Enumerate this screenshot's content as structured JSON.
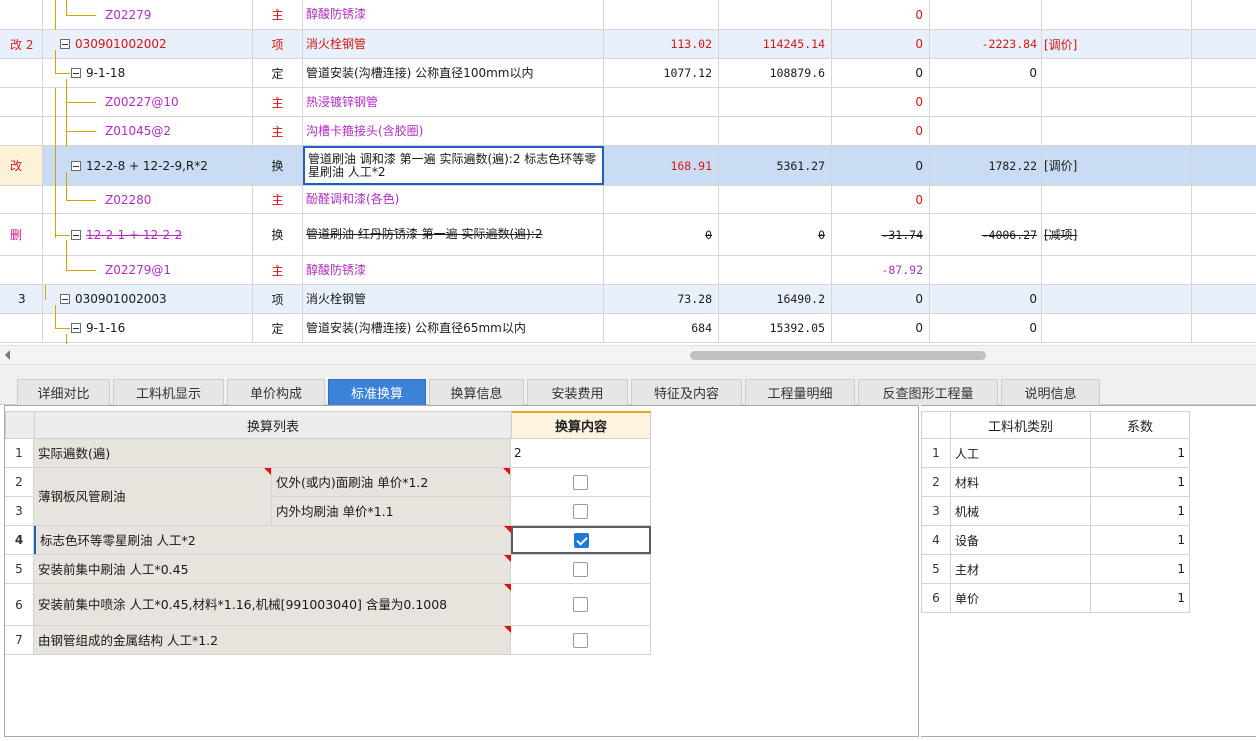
{
  "grid_rows": [
    {
      "mark": "",
      "code": "Z02279",
      "type": "主",
      "name": "醇酸防锈漆",
      "n1": "",
      "n2": "",
      "n3": "0",
      "n4": "",
      "note": ""
    },
    {
      "mark": "改 2",
      "code": "030901002002",
      "type": "项",
      "name": "消火栓钢管",
      "n1": "113.02",
      "n2": "114245.14",
      "n3": "0",
      "n4": "-2223.84",
      "note": "[调价]"
    },
    {
      "mark": "",
      "code": "9-1-18",
      "type": "定",
      "name": "管道安装(沟槽连接) 公称直径100mm以内",
      "n1": "1077.12",
      "n2": "108879.6",
      "n3": "0",
      "n4": "0",
      "note": ""
    },
    {
      "mark": "",
      "code": "Z00227@10",
      "type": "主",
      "name": "热浸镀锌钢管",
      "n1": "",
      "n2": "",
      "n3": "0",
      "n4": "",
      "note": ""
    },
    {
      "mark": "",
      "code": "Z01045@2",
      "type": "主",
      "name": "沟槽卡箍接头(含胶圈)",
      "n1": "",
      "n2": "",
      "n3": "0",
      "n4": "",
      "note": ""
    },
    {
      "mark": "改",
      "code": "12-2-8 + 12-2-9,R*2",
      "type": "换",
      "name": "管道刷油 调和漆 第一遍  实际遍数(遍):2 标志色环等零星刷油 人工*2",
      "n1": "168.91",
      "n2": "5361.27",
      "n3": "0",
      "n4": "1782.22",
      "note": "[调价]"
    },
    {
      "mark": "",
      "code": "Z02280",
      "type": "主",
      "name": "酚醛调和漆(各色)",
      "n1": "",
      "n2": "",
      "n3": "0",
      "n4": "",
      "note": ""
    },
    {
      "mark": "删",
      "code": "12-2-1 + 12-2-2",
      "type": "换",
      "name": "管道刷油 红丹防锈漆 第一遍  实际遍数(遍):2",
      "n1": "0",
      "n2": "0",
      "n3": "-31.74",
      "n4": "-4006.27",
      "note": "[减项]"
    },
    {
      "mark": "",
      "code": "Z02279@1",
      "type": "主",
      "name": "醇酸防锈漆",
      "n1": "",
      "n2": "",
      "n3": "-87.92",
      "n4": "",
      "note": ""
    },
    {
      "mark": "3",
      "code": "030901002003",
      "type": "项",
      "name": "消火栓钢管",
      "n1": "73.28",
      "n2": "16490.2",
      "n3": "0",
      "n4": "0",
      "note": ""
    },
    {
      "mark": "",
      "code": "9-1-16",
      "type": "定",
      "name": "管道安装(沟槽连接) 公称直径65mm以内",
      "n1": "684",
      "n2": "15392.05",
      "n3": "0",
      "n4": "0",
      "note": ""
    }
  ],
  "tabs": [
    "详细对比",
    "工料机显示",
    "单价构成",
    "标准换算",
    "换算信息",
    "安装费用",
    "特征及内容",
    "工程量明细",
    "反查图形工程量",
    "说明信息"
  ],
  "active_tab": "标准换算",
  "conv_table": {
    "header_list": "换算列表",
    "header_content": "换算内容",
    "rows": [
      {
        "idx": "1",
        "label": "实际遍数(遍)",
        "sub": "",
        "value": "2",
        "checked": null
      },
      {
        "idx": "2",
        "label": "薄钢板风管刷油",
        "sub": "仅外(或内)面刷油 单价*1.2",
        "value": "",
        "checked": false
      },
      {
        "idx": "3",
        "label": "",
        "sub": "内外均刷油 单价*1.1",
        "value": "",
        "checked": false
      },
      {
        "idx": "4",
        "label": "标志色环等零星刷油 人工*2",
        "sub": "",
        "value": "",
        "checked": true
      },
      {
        "idx": "5",
        "label": "安装前集中刷油 人工*0.45",
        "sub": "",
        "value": "",
        "checked": false
      },
      {
        "idx": "6",
        "label": "安装前集中喷涂 人工*0.45,材料*1.16,机械[991003040] 含量为0.1008",
        "sub": "",
        "value": "",
        "checked": false
      },
      {
        "idx": "7",
        "label": "由钢管组成的金属结构 人工*1.2",
        "sub": "",
        "value": "",
        "checked": false
      }
    ]
  },
  "coef_table": {
    "header_category": "工料机类别",
    "header_coef": "系数",
    "rows": [
      {
        "idx": "1",
        "category": "人工",
        "coef": "1"
      },
      {
        "idx": "2",
        "category": "材料",
        "coef": "1"
      },
      {
        "idx": "3",
        "category": "机械",
        "coef": "1"
      },
      {
        "idx": "4",
        "category": "设备",
        "coef": "1"
      },
      {
        "idx": "5",
        "category": "主材",
        "coef": "1"
      },
      {
        "idx": "6",
        "category": "单价",
        "coef": "1"
      }
    ]
  },
  "colors": {
    "accent": "#3b82d8",
    "red": "#d61414",
    "magenta": "#b12ec4"
  }
}
